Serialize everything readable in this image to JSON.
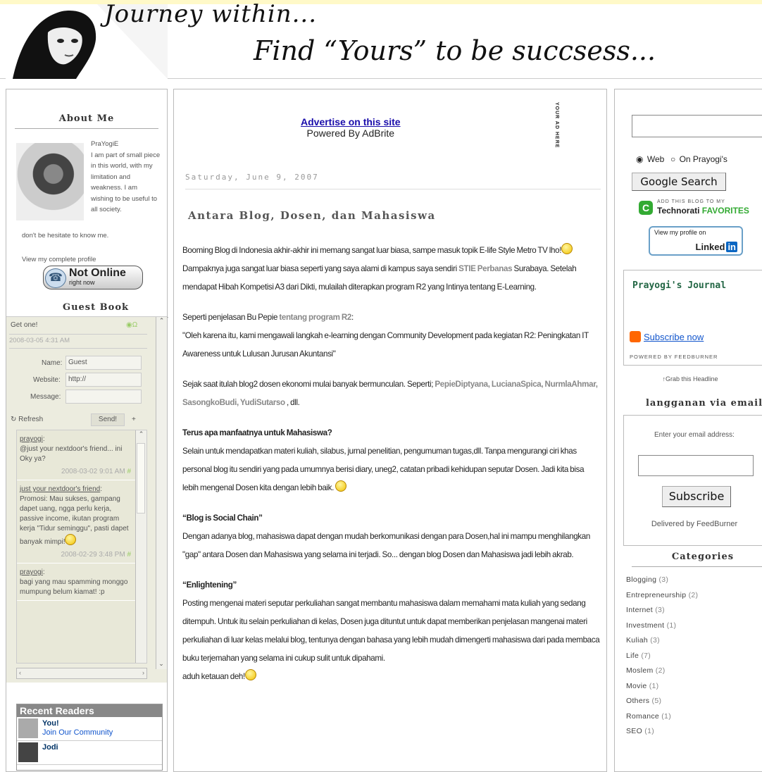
{
  "header": {
    "title_line1": "Journey within...",
    "title_line2": "Find “Yours” to be succsess..."
  },
  "about": {
    "heading": "About Me",
    "name": "PraYogiE",
    "bio": "I am part of small piece in this world, with my limitation and weakness. I am wishing to be useful to all society.",
    "bio_tail": "don't be hesitate to know me.",
    "view_profile": "View my complete profile",
    "status_main": "Not Online",
    "status_sub": "right now"
  },
  "guestbook": {
    "heading": "Guest Book",
    "get_one": "Get one!",
    "timestamp": "2008-03-05 4:31 AM",
    "name_label": "Name:",
    "name_value": "Guest",
    "website_label": "Website:",
    "website_value": "http://",
    "message_label": "Message:",
    "refresh": "Refresh",
    "send": "Send!",
    "plus": "+",
    "messages": [
      {
        "who": "prayogi",
        "text": "@just your nextdoor's friend... ini Oky ya?",
        "date": "2008-03-02 9:01 AM"
      },
      {
        "who": "just your nextdoor's friend",
        "text": "Promosi: Mau sukses, gampang dapet uang, ngga perlu kerja, passive income, ikutan program kerja \"Tidur seminggu\", pasti dapet banyak mimpi!",
        "date": "2008-02-29 3:48 PM"
      },
      {
        "who": "prayogi",
        "text": "bagi yang mau spamming monggo mumpung belum kiamat! :p",
        "date": ""
      }
    ]
  },
  "recent_readers": {
    "heading": "Recent Readers",
    "items": [
      {
        "name": "You!",
        "sub": "Join Our Community"
      },
      {
        "name": "Jodi",
        "sub": ""
      }
    ]
  },
  "ad": {
    "link": "Advertise on this site",
    "powered": "Powered By AdBrite",
    "vertical": "YOUR AD HERE"
  },
  "post": {
    "date": "Saturday, June 9, 2007",
    "title": "Antara Blog, Dosen, dan Mahasiswa",
    "p1a": "Booming Blog di Indonesia akhir-akhir ini memang sangat luar biasa, sampe masuk topik E-life Style Metro TV lho!",
    "p1b": " Dampaknya juga sangat luar biasa seperti yang saya alami di kampus saya sendiri ",
    "p1_link": "STIE Perbanas",
    "p1c": " Surabaya. Setelah mendapat Hibah Kompetisi A3 dari Dikti, mulailah diterapkan program R2 yang Intinya tentang E-Learning.",
    "p2a": "Seperti penjelasan Bu Pepie ",
    "p2_link": "tentang program R2",
    "p2b": ":",
    "p3": "\"Oleh karena itu, kami mengawali langkah e-learning dengan Community Development pada kegiatan R2: Peningkatan IT Awareness untuk Lulusan Jurusan Akuntansi\"",
    "p4a": "Sejak saat itulah blog2 dosen ekonomi mulai banyak bermunculan. Seperti; ",
    "p4_links": "PepieDiptyana, LucianaSpica, NurmlaAhmar, SasongkoBudi, YudiSutarso",
    "p4b": " , dll.",
    "h1": "Terus apa manfaatnya untuk Mahasiswa?",
    "p5": "Selain untuk mendapatkan materi kuliah, silabus, jurnal penelitian, pengumuman tugas,dll. Tanpa mengurangi ciri khas personal blog itu sendiri yang pada umumnya berisi diary, uneg2, catatan pribadi kehidupan seputar Dosen. Jadi kita bisa lebih mengenal Dosen kita dengan lebih baik.",
    "h2": "“Blog is Social Chain”",
    "p6": "Dengan adanya blog, mahasiswa dapat dengan mudah berkomunikasi dengan para Dosen,hal ini mampu menghilangkan \"gap\" antara Dosen dan Mahasiswa yang selama ini terjadi. So... dengan blog Dosen dan Mahasiswa jadi lebih akrab.",
    "h3": "“Enlightening”",
    "p7": "Posting mengenai materi seputar perkuliahan sangat membantu mahasiswa dalam memahami mata kuliah yang sedang ditempuh. Untuk itu selain perkuliahan di kelas, Dosen juga dituntut untuk dapat memberikan penjelasan mangenai materi perkuliahan di luar kelas melalui blog, tentunya dengan bahasa yang lebih mudah dimengerti mahasiswa dari pada membaca buku terjemahan yang selama ini cukup sulit untuk dipahami.",
    "p8": "aduh ketauan deh!"
  },
  "sidebar": {
    "radio_web": "Web",
    "radio_site": "On Prayogi's",
    "search_button": "Google Search",
    "technorati_small": "ADD THIS BLOG TO MY",
    "technorati_brand": "Technorati",
    "technorati_fav": "FAVORITES",
    "linkedin_small": "View my profile on",
    "linkedin_brand": "Linked",
    "linkedin_in": "in",
    "feed_title": "Prayogi's Journal",
    "feed_subscribe": "Subscribe now",
    "feed_powered": "POWERED BY FEEDBURNER",
    "grab": "↑Grab this Headline",
    "email_heading": "langganan via email",
    "email_label": "Enter your email address:",
    "subscribe_button": "Subscribe",
    "delivered": "Delivered by FeedBurner",
    "categories_heading": "Categories",
    "categories": [
      {
        "name": "Blogging",
        "count": "(3)"
      },
      {
        "name": "Entrepreneurship",
        "count": "(2)"
      },
      {
        "name": "Internet",
        "count": "(3)"
      },
      {
        "name": "Investment",
        "count": "(1)"
      },
      {
        "name": "Kuliah",
        "count": "(3)"
      },
      {
        "name": "Life",
        "count": "(7)"
      },
      {
        "name": "Moslem",
        "count": "(2)"
      },
      {
        "name": "Movie",
        "count": "(1)"
      },
      {
        "name": "Others",
        "count": "(5)"
      },
      {
        "name": "Romance",
        "count": "(1)"
      },
      {
        "name": "SEO",
        "count": "(1)"
      }
    ]
  }
}
